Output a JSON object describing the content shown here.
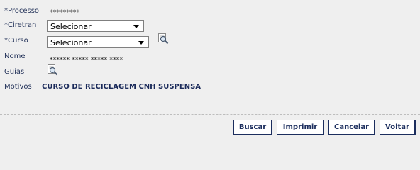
{
  "form": {
    "processo_label": "*Processo",
    "processo_value": "*********",
    "ciretran_label": "*Ciretran",
    "ciretran_selected": "Selecionar",
    "curso_label": "*Curso",
    "curso_selected": "Selecionar",
    "nome_label": "Nome",
    "nome_value": "****** ***** ***** ****",
    "guias_label": "Guias",
    "motivos_label": "Motivos",
    "motivos_value": "CURSO DE RECICLAGEM CNH SUSPENSA"
  },
  "buttons": {
    "buscar": "Buscar",
    "imprimir": "Imprimir",
    "cancelar": "Cancelar",
    "voltar": "Voltar"
  },
  "icons": [
    "magnifier-document-icon"
  ],
  "colors": {
    "label": "#24335a",
    "button_border": "#1c2e5e",
    "background": "#efefef"
  }
}
